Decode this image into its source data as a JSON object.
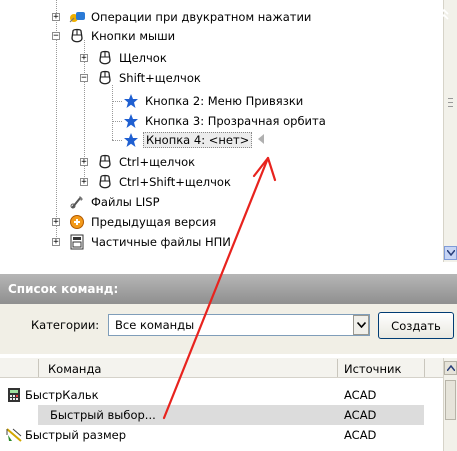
{
  "tree": {
    "items": [
      {
        "label": "Операции при двукратном нажатии",
        "icon": "double-click-icon"
      },
      {
        "label": "Кнопки мыши",
        "icon": "mouse-icon"
      },
      {
        "label": "Щелчок",
        "icon": "mouse-icon"
      },
      {
        "label": "Shift+щелчок",
        "icon": "mouse-icon"
      },
      {
        "label": "Кнопка 2: Меню Привязки",
        "icon": "star-icon"
      },
      {
        "label": "Кнопка 3: Прозрачная орбита",
        "icon": "star-icon"
      },
      {
        "label": "Кнопка 4: <нет>",
        "icon": "star-icon",
        "selected": true
      },
      {
        "label": "Ctrl+щелчок",
        "icon": "mouse-icon"
      },
      {
        "label": "Ctrl+Shift+щелчок",
        "icon": "mouse-icon"
      },
      {
        "label": "Файлы LISP",
        "icon": "lisp-icon"
      },
      {
        "label": "Предыдущая версия",
        "icon": "previous-version-icon"
      },
      {
        "label": "Частичные файлы НПИ",
        "icon": "cui-file-icon"
      }
    ]
  },
  "panel": {
    "title": "Список команд:",
    "category_label": "Категории:",
    "category_value": "Все команды",
    "create_button": "Создать"
  },
  "table": {
    "columns": {
      "command": "Команда",
      "source": "Источник"
    },
    "rows": [
      {
        "name": "БыстрКальк",
        "source": "ACAD",
        "icon": "calculator-icon"
      },
      {
        "name": "Быстрый выбор...",
        "source": "ACAD",
        "icon": "",
        "selected": true
      },
      {
        "name": "Быстрый размер",
        "source": "ACAD",
        "icon": "quick-dimension-icon"
      }
    ]
  },
  "colors": {
    "annotation_arrow": "#e8231e",
    "panel_header": "#9c9c9c",
    "star": "#1f5fd1"
  }
}
